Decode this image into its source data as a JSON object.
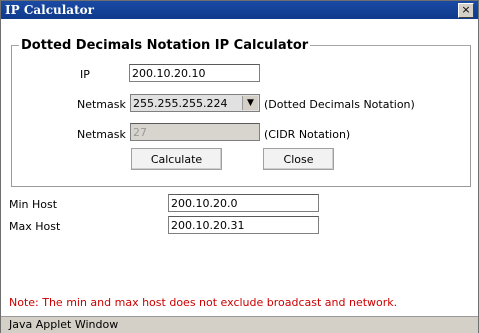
{
  "window": {
    "title": "IP Calculator",
    "close_glyph": "×",
    "status_text": "Java Applet Window"
  },
  "calculator": {
    "legend": "Dotted Decimals Notation IP Calculator",
    "ip_label": "IP",
    "ip_value": "200.10.20.10",
    "netmask_label": "Netmask",
    "netmask_value": "255.255.255.224",
    "netmask_desc": "(Dotted Decimals Notation)",
    "cidr_label": "Netmask",
    "cidr_value": "27",
    "cidr_desc": "(CIDR Notation)",
    "calculate_label": "Calculate",
    "close_label": "Close"
  },
  "results": {
    "min_label": "Min Host",
    "min_value": "200.10.20.0",
    "max_label": "Max Host",
    "max_value": "200.10.20.31"
  },
  "note": "Note: The min and max host does not exclude broadcast and network."
}
